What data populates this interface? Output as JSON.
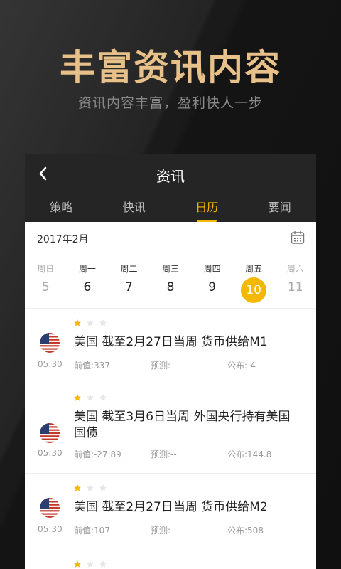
{
  "hero": {
    "title": "丰富资讯内容",
    "subtitle": "资讯内容丰富，盈利快人一步"
  },
  "app": {
    "title": "资讯",
    "back_icon": "chevron-left-icon",
    "tabs": [
      "策略",
      "快讯",
      "日历",
      "要闻"
    ],
    "active_tab": 2
  },
  "calendar": {
    "month_label": "2017年2月",
    "icon": "calendar-icon",
    "days": [
      {
        "name": "周日",
        "date": "5"
      },
      {
        "name": "周一",
        "date": "6"
      },
      {
        "name": "周二",
        "date": "7"
      },
      {
        "name": "周三",
        "date": "8"
      },
      {
        "name": "周四",
        "date": "9"
      },
      {
        "name": "周五",
        "date": "10"
      },
      {
        "name": "周六",
        "date": "11"
      }
    ],
    "selected_index": 5
  },
  "events": [
    {
      "stars_filled": 1,
      "stars_total": 3,
      "flag": "us-flag-icon",
      "time": "05:30",
      "title": "美国 截至2月27日当周 货币供给M1",
      "previous": "前值:337",
      "forecast": "预测:--",
      "actual": "公布:-4"
    },
    {
      "stars_filled": 1,
      "stars_total": 3,
      "flag": "us-flag-icon",
      "time": "05:30",
      "title": "美国 截至3月6日当周 外国央行持有美国国债",
      "previous": "前值:-27.89",
      "forecast": "预测:--",
      "actual": "公布:144.8"
    },
    {
      "stars_filled": 1,
      "stars_total": 3,
      "flag": "us-flag-icon",
      "time": "05:30",
      "title": "美国 截至2月27日当周 货币供给M2",
      "previous": "前值:107",
      "forecast": "预测:--",
      "actual": "公布:508"
    },
    {
      "stars_filled": 1,
      "stars_total": 3,
      "flag": "us-flag-icon",
      "time": "",
      "title": "",
      "previous": "",
      "forecast": "",
      "actual": ""
    }
  ],
  "colors": {
    "accent": "#f5b800",
    "hero_title": "#e8c08a",
    "appbar": "#252525"
  }
}
